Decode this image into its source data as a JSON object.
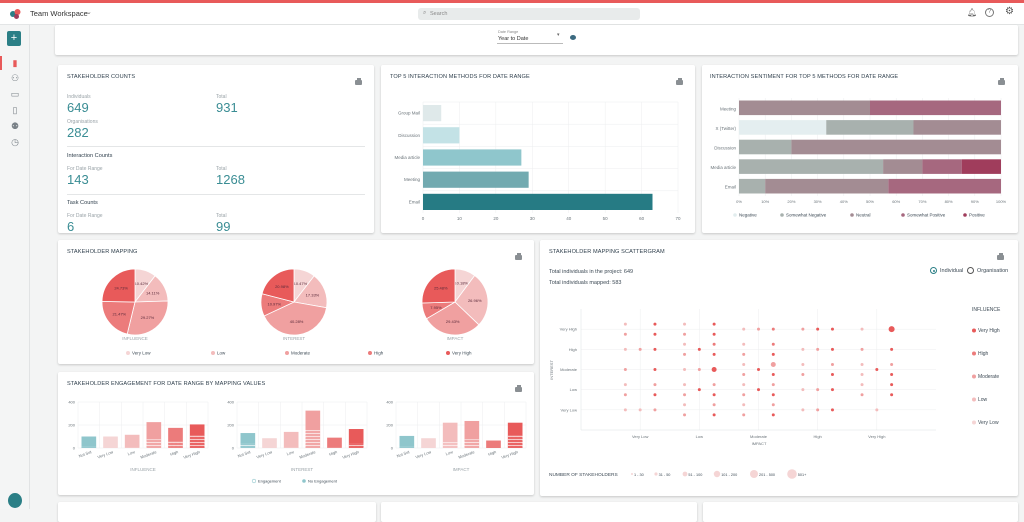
{
  "header": {
    "workspace": "Team Workspace",
    "search_placeholder": "Search"
  },
  "filters": {
    "date_range_label": "Date Range",
    "date_range_value": "Year to Date"
  },
  "counts": {
    "title": "Stakeholder Counts",
    "individuals_label": "Individuals",
    "individuals": "649",
    "organisations_label": "Organisations",
    "organisations": "282",
    "total_label": "Total",
    "stakeholder_total": "931",
    "interaction_title": "Interaction Counts",
    "for_range_label": "For Date Range",
    "interaction_range": "143",
    "interaction_total": "1268",
    "task_title": "Task Counts",
    "task_range": "6",
    "task_total": "99"
  },
  "colors": {
    "accent": "#2b7f86",
    "brand_red": "#e85a5a",
    "very_low": "#f5d5d5",
    "low": "#f3bcbc",
    "moderate": "#f0a0a0",
    "high": "#ec7b7b",
    "very_high": "#e85a5a",
    "not_set": "#8fc6cc"
  },
  "chart_data": [
    {
      "id": "methods",
      "type": "bar",
      "orientation": "horizontal",
      "title": "Top 5 Interaction Methods for Date Range",
      "categories": [
        "Group Mail",
        "Discussion",
        "Media article",
        "Meeting",
        "Email"
      ],
      "values": [
        5,
        10,
        27,
        29,
        63
      ],
      "colors": [
        "#dfe9ea",
        "#c3e2e6",
        "#8fc6cc",
        "#72aab0",
        "#267b84"
      ],
      "xlim": [
        0,
        70
      ],
      "xticks": [
        "0",
        "10",
        "20",
        "30",
        "40",
        "50",
        "60",
        "70"
      ],
      "grid": true
    },
    {
      "id": "sentiment",
      "type": "bar",
      "stacked": true,
      "orientation": "horizontal",
      "title": "Interaction Sentiment for Top 5 Methods for Date Range",
      "categories": [
        "Meeting",
        "X (Twitter)",
        "Discussion",
        "Media article",
        "Email"
      ],
      "series": [
        {
          "name": "Negative",
          "color": "#e2edee",
          "values": [
            0,
            33.3,
            0,
            0,
            0
          ]
        },
        {
          "name": "Somewhat Negative",
          "color": "#a8b1ae",
          "values": [
            0,
            33.3,
            20,
            55,
            10
          ]
        },
        {
          "name": "Neutral",
          "color": "#a38c93",
          "values": [
            50,
            33.4,
            80,
            15,
            47
          ]
        },
        {
          "name": "Somewhat Positive",
          "color": "#a6687f",
          "values": [
            50,
            0,
            0,
            15,
            43
          ]
        },
        {
          "name": "Positive",
          "color": "#a03d5c",
          "values": [
            0,
            0,
            0,
            15,
            0
          ]
        }
      ],
      "xlim": [
        0,
        100
      ],
      "xticks": [
        "0%",
        "10%",
        "20%",
        "30%",
        "40%",
        "50%",
        "60%",
        "70%",
        "80%",
        "90%",
        "100%"
      ],
      "legend": "bottom"
    },
    {
      "id": "mapping",
      "type": "pie",
      "title": "Stakeholder Mapping",
      "categories": [
        "Very Low",
        "Low",
        "Moderate",
        "High",
        "Very High"
      ],
      "pies": [
        {
          "label": "INFLUENCE",
          "values": [
            10.42,
            14.11,
            29.27,
            21.47,
            24.73
          ],
          "labels": [
            "10.42%",
            "14.11%",
            "29.27%",
            "21.47%",
            "24.73%"
          ]
        },
        {
          "label": "INTEREST",
          "values": [
            10.47,
            17.33,
            40.28,
            10.97,
            20.98
          ],
          "labels": [
            "10.47%",
            "17.33%",
            "40.28%",
            "10.97%",
            "20.98%"
          ]
        },
        {
          "label": "IMPACT",
          "values": [
            10.18,
            26.96,
            29.43,
            7.95,
            25.48
          ],
          "labels": [
            "10.18%",
            "26.96%",
            "29.43%",
            "7.95%",
            "25.48%"
          ]
        }
      ],
      "legend": "bottom"
    },
    {
      "id": "engagement",
      "type": "bar",
      "stacked": true,
      "title": "Stakeholder Engagement for Date Range by Mapping Values",
      "categories": [
        "Not Set",
        "Very Low",
        "Low",
        "Moderate",
        "High",
        "Very High"
      ],
      "ylim": [
        0,
        400
      ],
      "yticks": [
        "0",
        "200",
        "400"
      ],
      "series_names": [
        "Engagement",
        "No Engagement"
      ],
      "groups": [
        {
          "label": "INFLUENCE",
          "engagement": [
            10,
            0,
            5,
            75,
            55,
            110
          ],
          "no_engagement": [
            90,
            100,
            110,
            150,
            120,
            95
          ]
        },
        {
          "label": "INTEREST",
          "engagement": [
            40,
            0,
            5,
            155,
            5,
            40
          ],
          "no_engagement": [
            90,
            85,
            135,
            170,
            85,
            125
          ]
        },
        {
          "label": "IMPACT",
          "engagement": [
            10,
            0,
            50,
            75,
            0,
            110
          ],
          "no_engagement": [
            95,
            85,
            170,
            160,
            65,
            110
          ]
        }
      ],
      "legend": "bottom"
    },
    {
      "id": "scatter",
      "type": "scatter",
      "title": "Stakeholder Mapping Scattergram",
      "summary": [
        "Total individuals in the project: 649",
        "Total individuals mapped: 583"
      ],
      "toggle": {
        "options": [
          "Individual",
          "Organisation"
        ],
        "selected": "Individual"
      },
      "xlabel": "IMPACT",
      "ylabel": "INTEREST",
      "xlim": [
        0,
        6
      ],
      "ylim": [
        0,
        6
      ],
      "xticks": [
        "Very Low",
        "Low",
        "Moderate",
        "High",
        "Very High"
      ],
      "yticks": [
        "Very Low",
        "Low",
        "Moderate",
        "High",
        "Very High"
      ],
      "color_legend_title": "INFLUENCE",
      "influence_levels": [
        "Very Low",
        "Low",
        "Moderate",
        "High",
        "Very High"
      ],
      "size_legend_title": "NUMBER OF STAKEHOLDERS",
      "size_buckets": [
        "1 - 30",
        "31 - 50",
        "51 - 100",
        "101 - 200",
        "201 - 500",
        "501+"
      ],
      "points_format": [
        "impact",
        "interest",
        "influence_index",
        "size_bucket_index"
      ],
      "points": [
        [
          0.75,
          5.25,
          1,
          0
        ],
        [
          1.25,
          5.25,
          4,
          0
        ],
        [
          0.75,
          4.75,
          2,
          0
        ],
        [
          1.25,
          4.75,
          4,
          0
        ],
        [
          0.75,
          4,
          1,
          0
        ],
        [
          1,
          4,
          2,
          0
        ],
        [
          1.25,
          4,
          4,
          0
        ],
        [
          0.75,
          3,
          2,
          0
        ],
        [
          1.25,
          3,
          4,
          0
        ],
        [
          0.75,
          2.25,
          1,
          0
        ],
        [
          1.25,
          2.25,
          2,
          0
        ],
        [
          0.75,
          1.75,
          2,
          0
        ],
        [
          1.25,
          1.75,
          4,
          0
        ],
        [
          0.75,
          1,
          1,
          0
        ],
        [
          1,
          1,
          1,
          0
        ],
        [
          1.25,
          1,
          2,
          0
        ],
        [
          1.75,
          5.25,
          1,
          0
        ],
        [
          2.25,
          5.25,
          4,
          0
        ],
        [
          1.75,
          4.75,
          2,
          0
        ],
        [
          2.25,
          4.75,
          4,
          0
        ],
        [
          1.75,
          4.25,
          1,
          0
        ],
        [
          2.25,
          4.25,
          3,
          0
        ],
        [
          2,
          4,
          4,
          0
        ],
        [
          1.75,
          3.75,
          2,
          0
        ],
        [
          2.25,
          3.75,
          4,
          0
        ],
        [
          1.75,
          3,
          1,
          0
        ],
        [
          2,
          3,
          2,
          0
        ],
        [
          2.25,
          3,
          4,
          2
        ],
        [
          1.75,
          2.25,
          1,
          0
        ],
        [
          2.25,
          2.25,
          2,
          0
        ],
        [
          2,
          2,
          4,
          0
        ],
        [
          1.75,
          1.75,
          2,
          0
        ],
        [
          2.25,
          1.75,
          4,
          0
        ],
        [
          1.75,
          1.25,
          1,
          0
        ],
        [
          2.25,
          1.25,
          2,
          0
        ],
        [
          1.75,
          0.75,
          2,
          0
        ],
        [
          2.25,
          0.75,
          4,
          0
        ],
        [
          2.75,
          5,
          1,
          0
        ],
        [
          3,
          5,
          2,
          0
        ],
        [
          3.25,
          5,
          3,
          0
        ],
        [
          2.75,
          4.25,
          1,
          0
        ],
        [
          3.25,
          4.25,
          3,
          0
        ],
        [
          2.75,
          3.75,
          2,
          0
        ],
        [
          3.25,
          3.75,
          4,
          0
        ],
        [
          2.75,
          3.25,
          1,
          0
        ],
        [
          3.25,
          3.25,
          2,
          2
        ],
        [
          3,
          3,
          4,
          0
        ],
        [
          2.75,
          2.75,
          2,
          0
        ],
        [
          3.25,
          2.75,
          4,
          0
        ],
        [
          2.75,
          2.25,
          1,
          0
        ],
        [
          3.25,
          2.25,
          2,
          0
        ],
        [
          3,
          2,
          4,
          0
        ],
        [
          2.75,
          1.75,
          2,
          0
        ],
        [
          3.25,
          1.75,
          4,
          0
        ],
        [
          2.75,
          1.25,
          1,
          0
        ],
        [
          3.25,
          1.25,
          2,
          0
        ],
        [
          2.75,
          0.75,
          2,
          0
        ],
        [
          3.25,
          0.75,
          4,
          0
        ],
        [
          3.75,
          5,
          2,
          0
        ],
        [
          4,
          5,
          4,
          0
        ],
        [
          4.25,
          5,
          4,
          0
        ],
        [
          3.75,
          4,
          1,
          0
        ],
        [
          4,
          4,
          2,
          0
        ],
        [
          4.25,
          4,
          4,
          0
        ],
        [
          3.75,
          3.25,
          1,
          0
        ],
        [
          4.25,
          3.25,
          2,
          0
        ],
        [
          3.75,
          2.75,
          2,
          0
        ],
        [
          4.25,
          2.75,
          4,
          0
        ],
        [
          3.75,
          2,
          1,
          0
        ],
        [
          4,
          2,
          2,
          0
        ],
        [
          4.25,
          2,
          4,
          0
        ],
        [
          3.75,
          1,
          1,
          0
        ],
        [
          4,
          1,
          2,
          0
        ],
        [
          4.25,
          1,
          4,
          0
        ],
        [
          4.75,
          5,
          1,
          0
        ],
        [
          5.25,
          5,
          4,
          3
        ],
        [
          4.75,
          4,
          2,
          0
        ],
        [
          5.25,
          4,
          4,
          0
        ],
        [
          4.75,
          3.25,
          1,
          0
        ],
        [
          5.25,
          3.25,
          2,
          0
        ],
        [
          5,
          3,
          4,
          0
        ],
        [
          4.75,
          2.75,
          1,
          0
        ],
        [
          5.25,
          2.75,
          4,
          0
        ],
        [
          4.75,
          2.25,
          1,
          0
        ],
        [
          5.25,
          2.25,
          4,
          0
        ],
        [
          4.75,
          1.75,
          2,
          0
        ],
        [
          5.25,
          1.75,
          4,
          0
        ],
        [
          5,
          1,
          1,
          0
        ]
      ]
    }
  ]
}
